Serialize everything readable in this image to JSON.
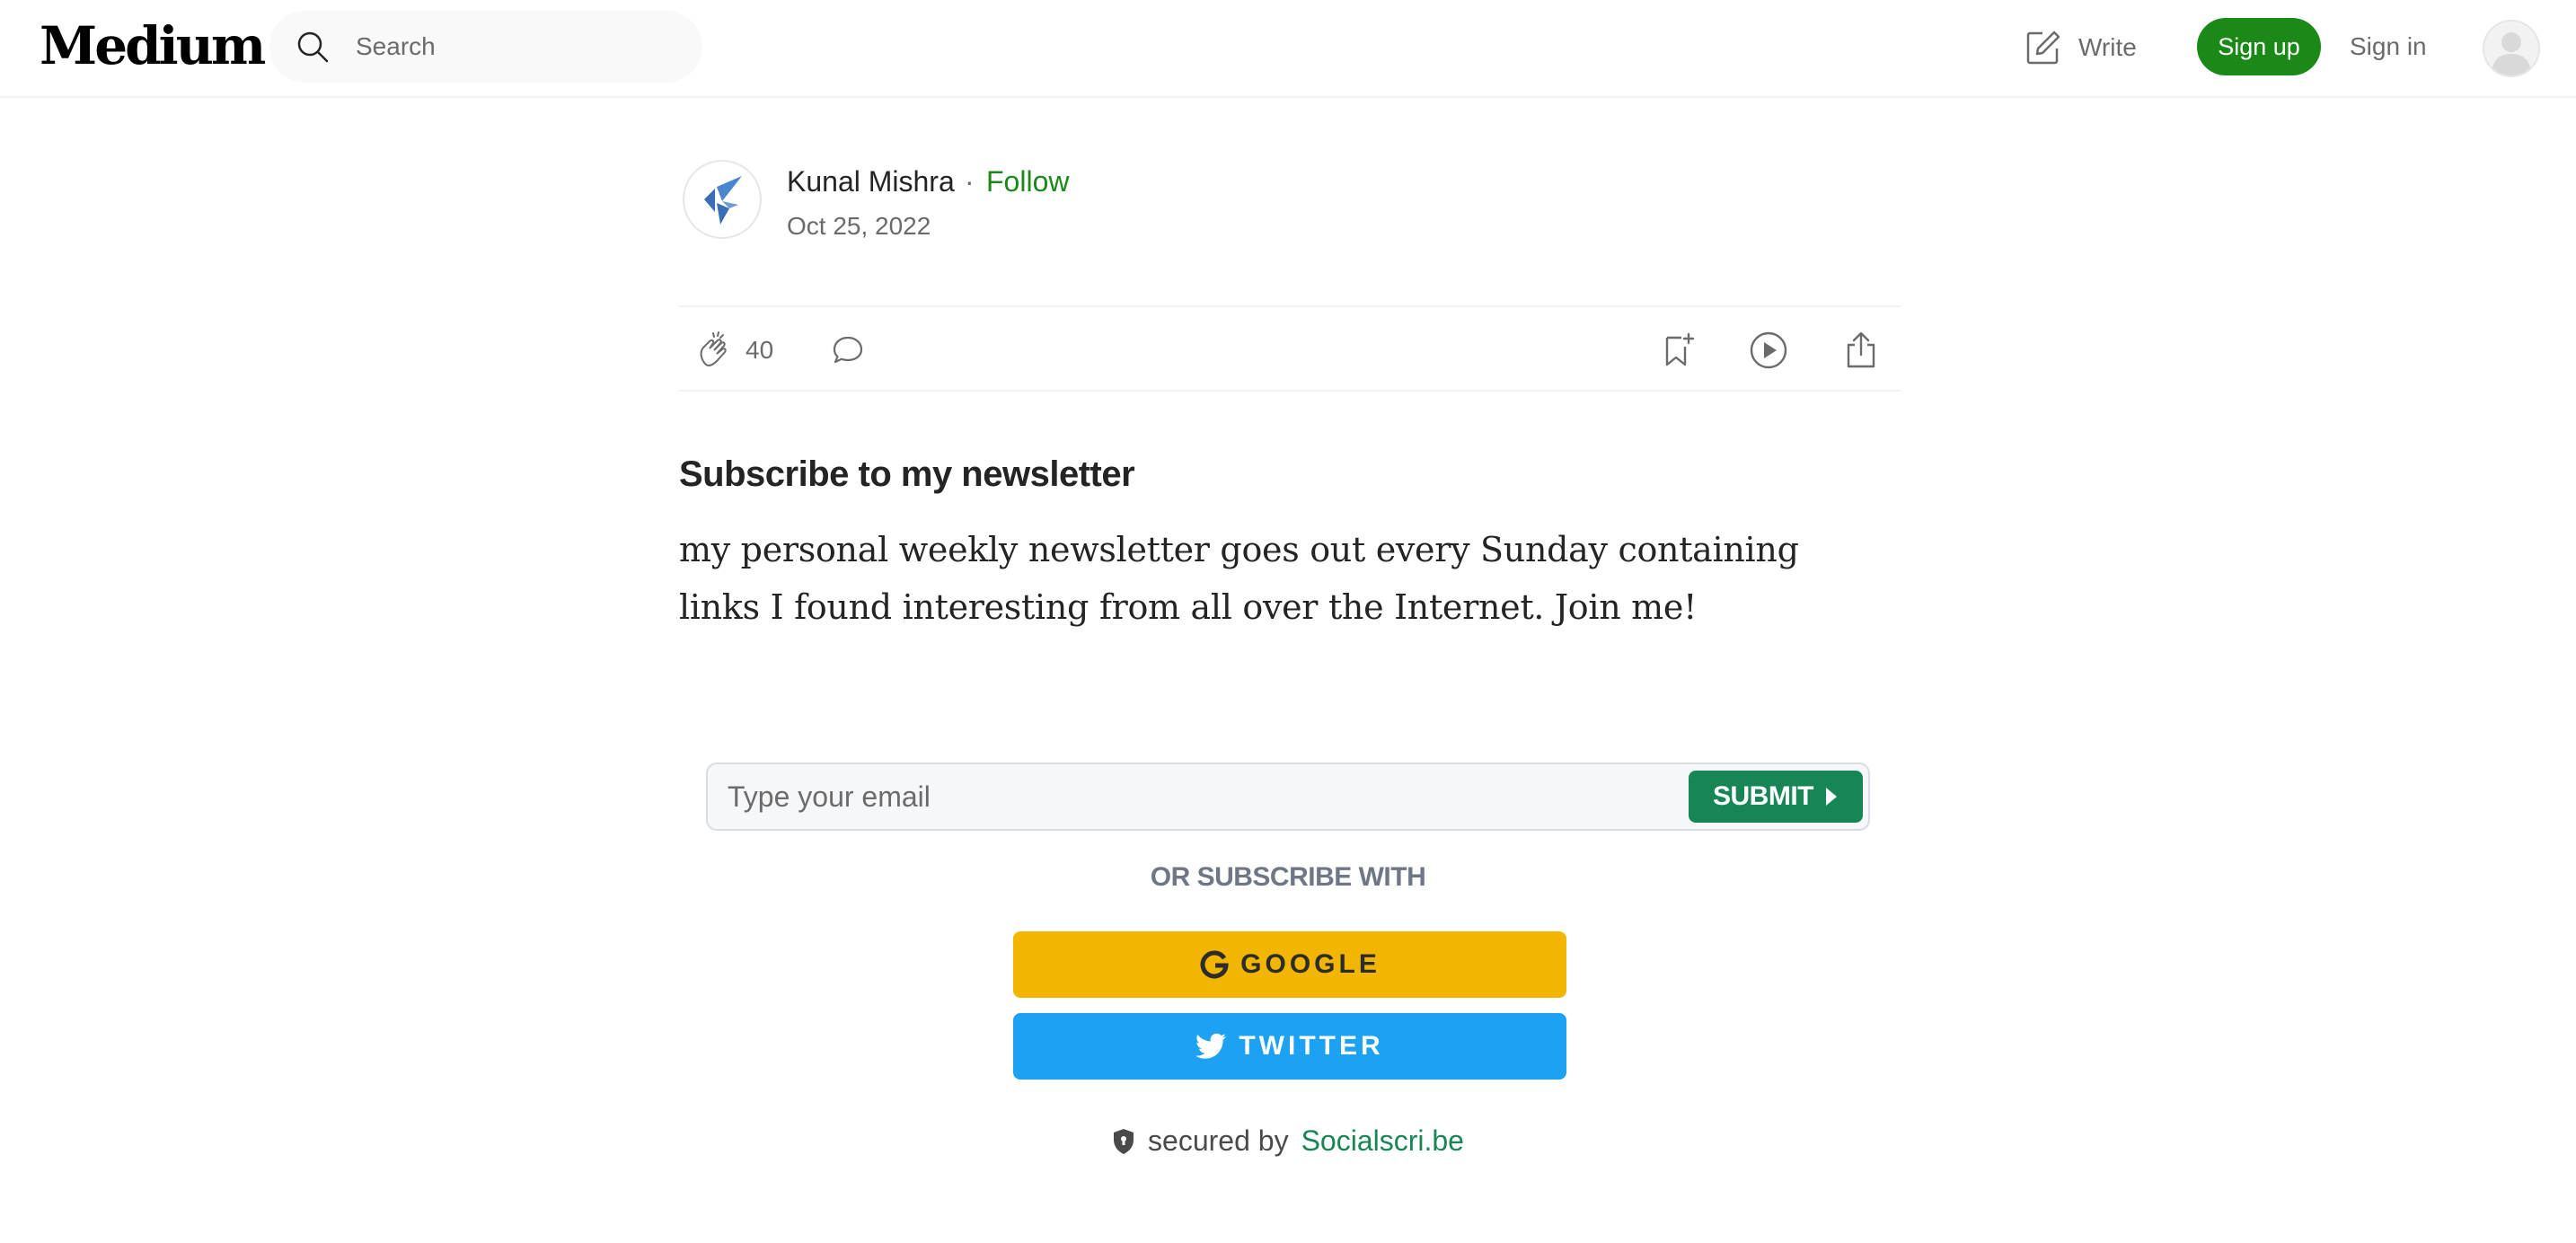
{
  "header": {
    "logo": "Medium",
    "search_placeholder": "Search",
    "write_label": "Write",
    "signup_label": "Sign up",
    "signin_label": "Sign in"
  },
  "author": {
    "name": "Kunal Mishra",
    "separator": "·",
    "follow_label": "Follow",
    "date": "Oct 25, 2022"
  },
  "actions": {
    "clap_count": "40"
  },
  "article": {
    "heading": "Subscribe to my newsletter",
    "paragraph": "my personal weekly newsletter goes out every Sunday containing links I found interesting from all over the Internet. Join me!"
  },
  "subscribe": {
    "email_placeholder": "Type your email",
    "submit_label": "SUBMIT",
    "or_label": "OR SUBSCRIBE WITH",
    "google_label": "GOOGLE",
    "twitter_label": "TWITTER",
    "secured_prefix": "secured by",
    "secured_link": "Socialscri.be"
  },
  "colors": {
    "brand_green": "#1a8917",
    "submit_green": "#188554",
    "google_yellow": "#f2b600",
    "twitter_blue": "#1da1f2",
    "muted_text": "#6b6b6b"
  },
  "icons": [
    "search-icon",
    "write-icon",
    "user-avatar-icon",
    "author-logo-icon",
    "clap-icon",
    "comment-icon",
    "bookmark-add-icon",
    "play-icon",
    "share-icon",
    "play-triangle-icon",
    "google-icon",
    "twitter-icon",
    "shield-icon"
  ]
}
